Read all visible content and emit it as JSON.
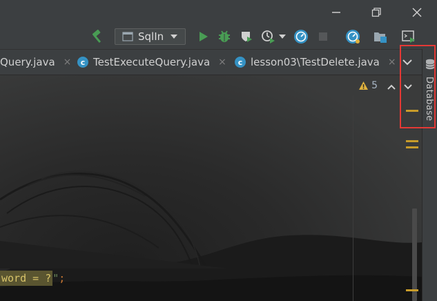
{
  "window_controls": {
    "minimize": "minimize-icon",
    "restore": "restore-icon",
    "close": "close-icon"
  },
  "toolbar": {
    "run_config": {
      "label": "SqlIn"
    },
    "icons": [
      "hammer-icon",
      "run-icon",
      "debug-icon",
      "coverage-icon",
      "profile-icon",
      "chevron-down-icon",
      "update-icon",
      "stop-icon",
      "performance-icon",
      "project-structure-icon",
      "terminal-icon"
    ]
  },
  "tabs": [
    {
      "label": "Query.java",
      "close": "×"
    },
    {
      "label": "TestExecuteQuery.java",
      "close": "×"
    },
    {
      "label": "lesson03\\TestDelete.java",
      "close": "×"
    }
  ],
  "editor": {
    "inspection_count": "5",
    "code_selected": "word = ?",
    "code_quote": "\"",
    "code_semicolon": ";"
  },
  "right_strip": {
    "database_label": "Database"
  },
  "colors": {
    "accent_green": "#499c54",
    "tab_icon": "#3592c4",
    "warning": "#e0b23e",
    "highlight": "#e53935"
  }
}
